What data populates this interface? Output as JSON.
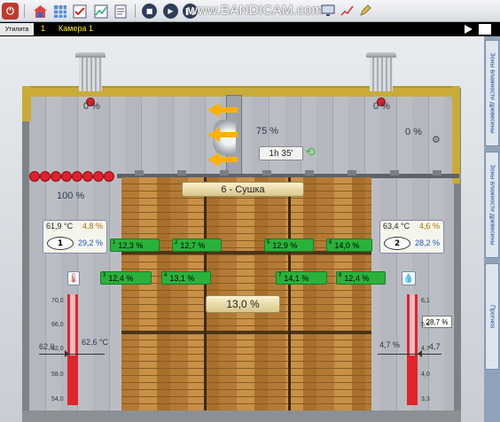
{
  "toolbar": {
    "watermark": "www.BANDICAM.com",
    "power_icon": "⏻",
    "icons": [
      "house-icon",
      "grid-icon",
      "checklist-icon",
      "chart-icon",
      "document-icon",
      "stop-icon",
      "play-icon",
      "pause-icon",
      "fast-forward-icon",
      "screen-icon",
      "pencil-icon"
    ]
  },
  "statusbar": {
    "utility_label": "Утилита",
    "camera_number": "1",
    "camera_name": "Камера 1"
  },
  "side_tabs": [
    "Зоны влажности древесины",
    "Зоны влажности древесины",
    "Прогноз"
  ],
  "scene": {
    "vent_left_pct": "0 %",
    "vent_right_pct": "0 %",
    "vent_right2_pct": "0 %",
    "fan_pct": "75 %",
    "timer": "1h 35'",
    "heater_pct": "100 %",
    "stage": "6 - Сушка",
    "center_humidity": "13,0 %",
    "left_box": {
      "temp": "61,9 °C",
      "pct_top": "4,8 %",
      "num": "1",
      "pct_bottom": "29,2 %"
    },
    "right_box": {
      "temp": "63,4 °C",
      "pct_top": "4,6 %",
      "num": "2",
      "pct_bottom": "28,2 %"
    },
    "sensors_row1": [
      {
        "n": "1",
        "v": "12,3 %"
      },
      {
        "n": "2",
        "v": "12,7 %"
      },
      {
        "n": "5",
        "v": "12,9 %"
      },
      {
        "n": "6",
        "v": "14,0 %"
      }
    ],
    "sensors_row2": [
      {
        "n": "3",
        "v": "12,4 %"
      },
      {
        "n": "4",
        "v": "13,1 %"
      },
      {
        "n": "7",
        "v": "14,1 %"
      },
      {
        "n": "8",
        "v": "12,4 %"
      }
    ],
    "left_scale": {
      "ticks": [
        "70,0",
        "66,0",
        "62,0",
        "58,0",
        "54,0"
      ],
      "current_label": "62,0",
      "current_value": "62,6 °C"
    },
    "right_scale": {
      "ticks": [
        "6,1",
        "5,4",
        "4,7",
        "4,0",
        "3,3"
      ],
      "current_label": "4,7",
      "current_value": "4,7 %"
    },
    "hygro_value": "28,7 %",
    "colors": {
      "alarm_red": "#e0202a",
      "sensor_green": "#29b23b",
      "roof_yellow": "#c9ab38",
      "arrow_orange": "#ffb000"
    }
  }
}
